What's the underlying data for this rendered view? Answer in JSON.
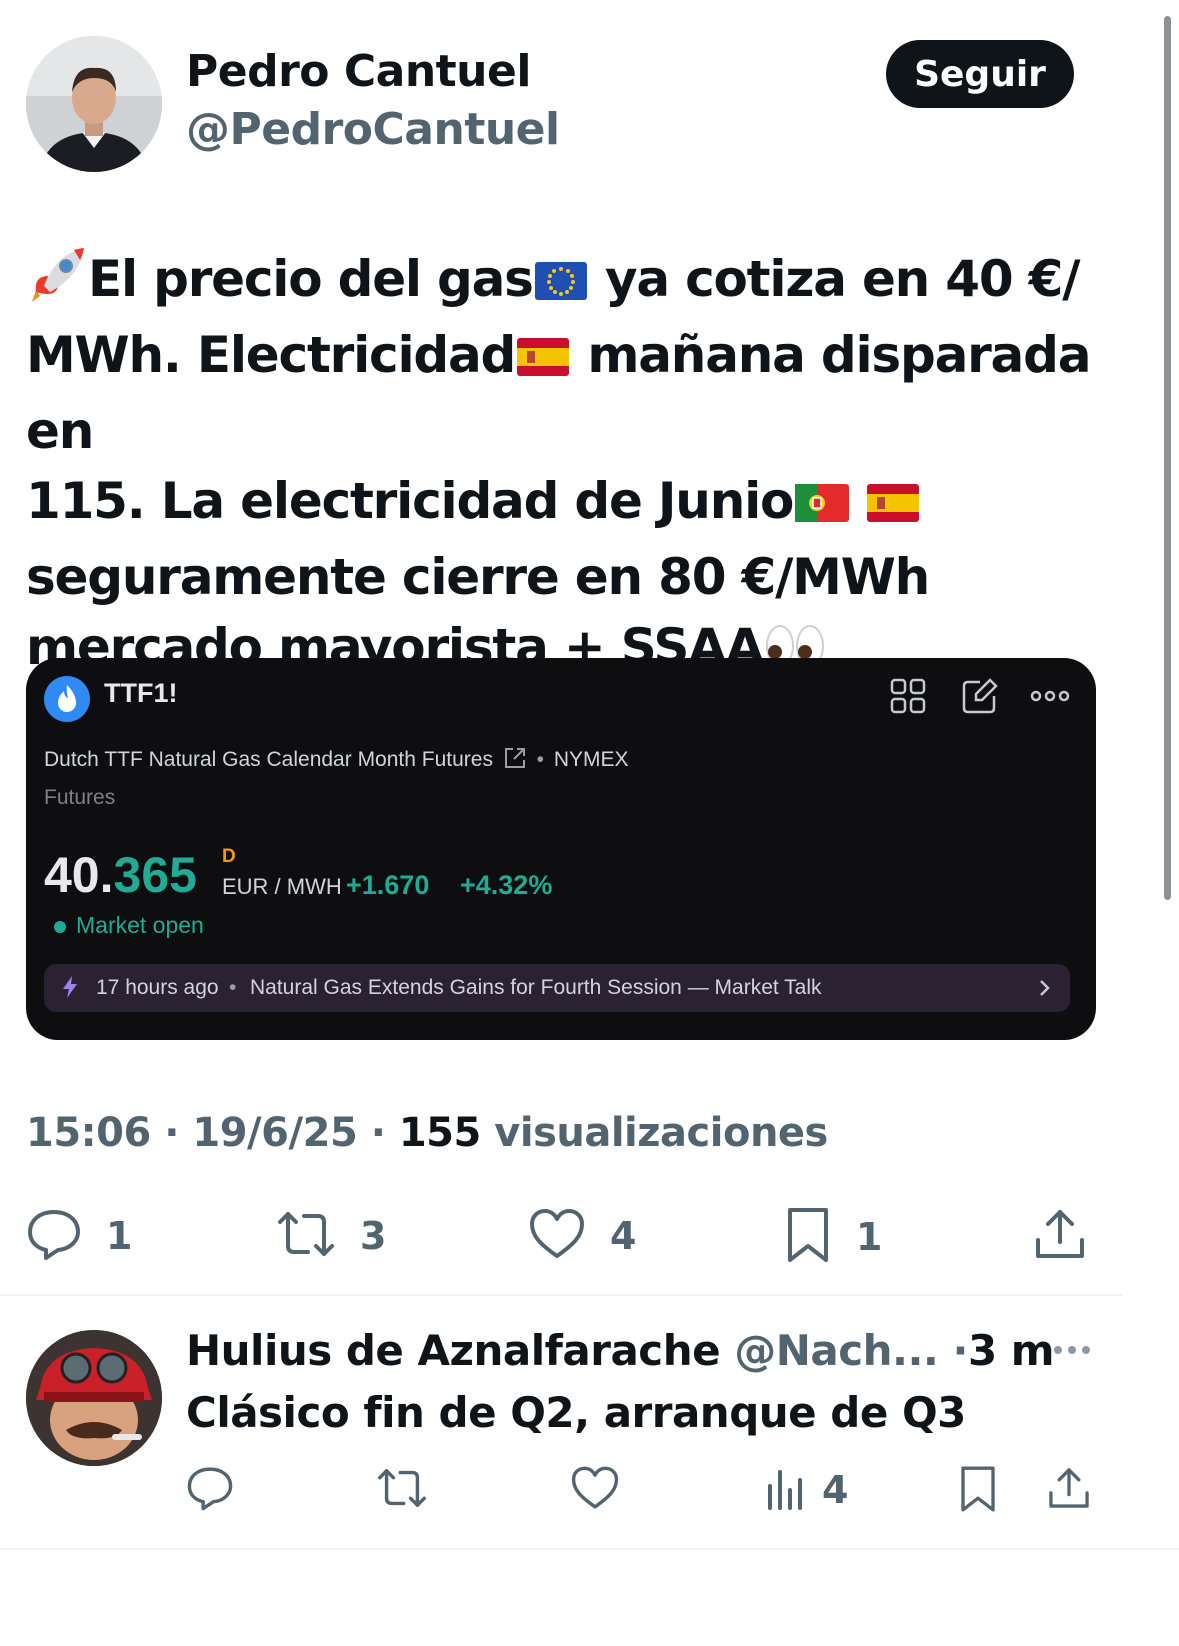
{
  "tweet": {
    "author_name": "Pedro Cantuel",
    "author_handle": "@PedroCantuel",
    "follow_label": "Seguir",
    "text": {
      "l1a": "El precio del gas",
      "l1b": " ya cotiza en 40 €/",
      "l2a": "MWh. Electricidad",
      "l2b": " mañana disparada en",
      "l3a": "115. La electricidad de Junio",
      "l4": "seguramente cierre en 80 €/MWh",
      "l5": "mercado mayorista + SSAA"
    },
    "emoji_names": [
      "rocket",
      "flag-eu",
      "flag-es",
      "flag-pt",
      "flag-es",
      "eyes"
    ],
    "time": "15:06",
    "date": "19/6/25",
    "views_count": "155",
    "views_label": "visualizaciones",
    "actions": {
      "replies": "1",
      "retweets": "3",
      "likes": "4",
      "bookmarks": "1"
    }
  },
  "card": {
    "symbol": "TTF1!",
    "description": "Dutch TTF Natural Gas Calendar Month Futures",
    "exchange": "NYMEX",
    "separator": "•",
    "category": "Futures",
    "price_int": "40.",
    "price_dec": "365",
    "period": "D",
    "unit": "EUR / MWH",
    "change": "+1.670",
    "change_pct": "+4.32%",
    "market_status": "Market open",
    "news_time": "17 hours ago",
    "news_headline": "Natural Gas Extends Gains for Fourth Session — Market Talk",
    "colors": {
      "background": "#0e0e10",
      "positive": "#22ab94",
      "period": "#ff9800",
      "news_bg": "#2a2233"
    }
  },
  "reply": {
    "author_name": "Hulius de Aznalfarache",
    "author_handle": "@Nach...",
    "sep": "·",
    "time_ago": "3 m",
    "text": "Clásico fin de Q2, arranque de Q3",
    "views": "4"
  },
  "icons": [
    "reply-icon",
    "retweet-icon",
    "like-icon",
    "bookmark-icon",
    "share-icon",
    "views-icon",
    "more-icon",
    "grid-icon",
    "edit-icon",
    "flame-icon",
    "bolt-icon",
    "chevron-right-icon",
    "external-link-icon"
  ]
}
